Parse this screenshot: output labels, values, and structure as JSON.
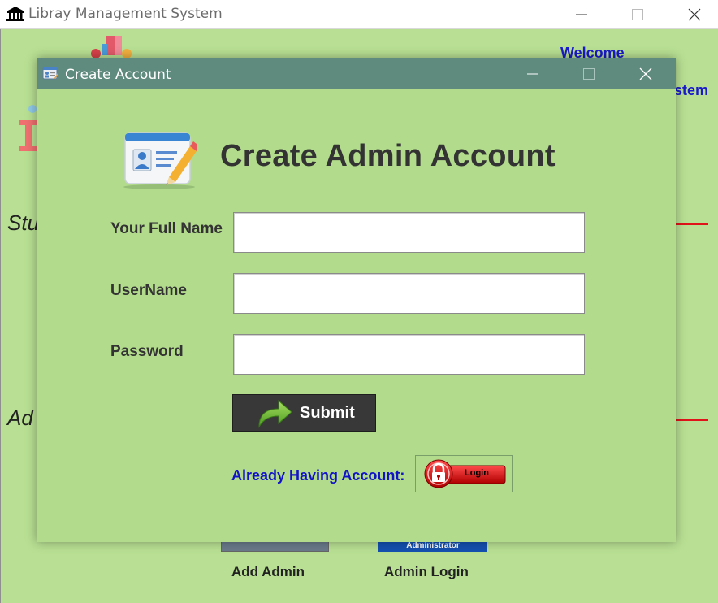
{
  "main_window": {
    "title": "Libray Management System",
    "welcome": "Welcome",
    "system_fragment": "stem",
    "student_fragment": "Stu",
    "admin_fragment": "Ad",
    "add_admin_caption": "Add Admin",
    "admin_login_caption": "Admin Login",
    "admin_login_image_text": "Administrator"
  },
  "dialog": {
    "title": "Create Account",
    "heading": "Create Admin Account",
    "fields": {
      "full_name_label": "Your Full Name",
      "full_name_value": "",
      "username_label": "UserName",
      "username_value": "",
      "password_label": "Password",
      "password_value": ""
    },
    "submit_label": "Submit",
    "already_text": "Already Having Account:",
    "login_label": "Login"
  },
  "colors": {
    "window_bg": "#b8df93",
    "dialog_bg": "#b2dc8c",
    "dialog_titlebar": "#5f8a7e",
    "link_blue": "#1212c8",
    "accent_red": "#e0131a"
  },
  "icons": {
    "app_icon": "bank-icon",
    "dialog_icon": "id-card-icon",
    "header_icon": "id-card-pencil-icon",
    "submit_icon": "arrow-right-icon",
    "login_icon": "lock-icon"
  }
}
